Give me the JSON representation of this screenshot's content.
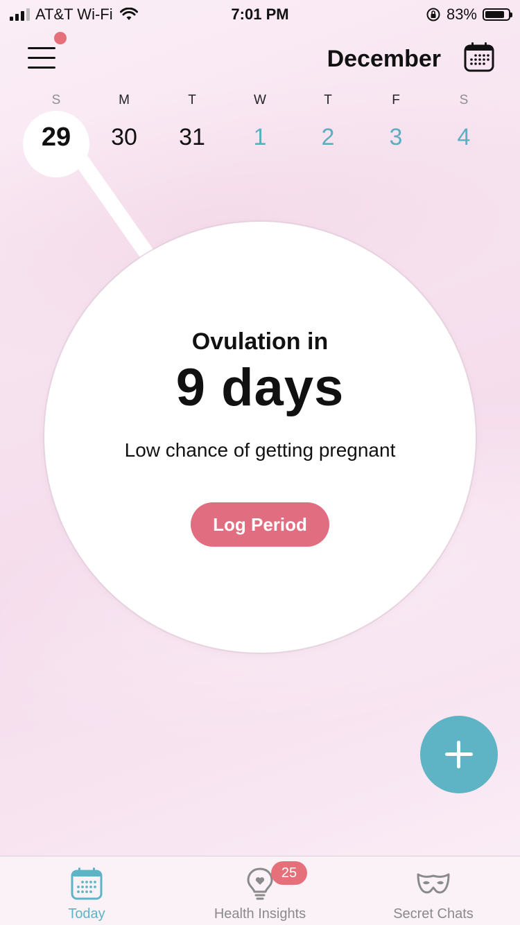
{
  "status_bar": {
    "carrier": "AT&T Wi-Fi",
    "time": "7:01 PM",
    "battery_percent": "83%",
    "battery_level": 0.83
  },
  "header": {
    "month": "December",
    "menu_has_notification": true
  },
  "week": {
    "days": [
      {
        "letter": "S",
        "number": "29",
        "selected": true,
        "future": false
      },
      {
        "letter": "M",
        "number": "30",
        "selected": false,
        "future": false
      },
      {
        "letter": "T",
        "number": "31",
        "selected": false,
        "future": false
      },
      {
        "letter": "W",
        "number": "1",
        "selected": false,
        "future": true
      },
      {
        "letter": "T",
        "number": "2",
        "selected": false,
        "future": true
      },
      {
        "letter": "F",
        "number": "3",
        "selected": false,
        "future": true
      },
      {
        "letter": "S",
        "number": "4",
        "selected": false,
        "future": true
      }
    ]
  },
  "summary": {
    "label": "Ovulation in",
    "days": "9 days",
    "chance": "Low chance of getting pregnant",
    "log_button": "Log Period"
  },
  "tabs": [
    {
      "label": "Today",
      "icon": "calendar-icon",
      "active": true
    },
    {
      "label": "Health Insights",
      "icon": "lightbulb-heart-icon",
      "active": false,
      "badge": "25"
    },
    {
      "label": "Secret Chats",
      "icon": "mask-icon",
      "active": false
    }
  ],
  "colors": {
    "accent_teal": "#5eb4c5",
    "accent_pink": "#e06d80",
    "badge_red": "#e5707a"
  }
}
